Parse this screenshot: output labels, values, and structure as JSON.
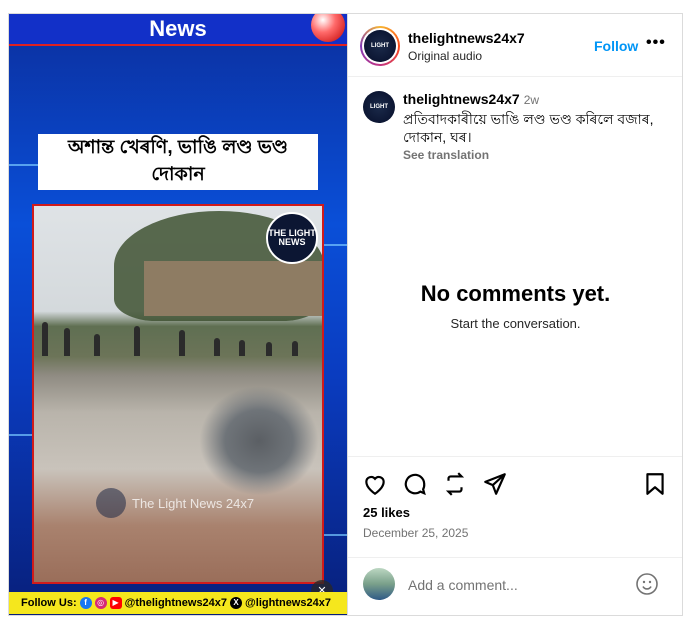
{
  "media": {
    "news_label": "News",
    "headline_line1": "অশান্ত খেৰণি, ভাঙি লণ্ড ভণ্ড",
    "headline_line2": "দোকান",
    "logo_text": "THE LIGHT NEWS",
    "watermark": "The Light News 24x7",
    "follow_bar": {
      "label": "Follow Us:",
      "handle1": "@thelightnews24x7",
      "handle2": "@lightnews24x7"
    }
  },
  "header": {
    "username": "thelightnews24x7",
    "audio": "Original audio",
    "follow_label": "Follow",
    "more_label": "•••"
  },
  "caption": {
    "username": "thelightnews24x7",
    "time": "2w",
    "text": "প্ৰতিবাদকাৰীয়ে ভাঙি লণ্ড ভণ্ড কৰিলে বজাৰ, দোকান, ঘৰ।",
    "see_translation": "See translation"
  },
  "comments": {
    "empty_title": "No comments yet.",
    "empty_subtitle": "Start the conversation."
  },
  "engagement": {
    "likes": "25 likes",
    "date": "December 25, 2025"
  },
  "composer": {
    "placeholder": "Add a comment..."
  },
  "icons": [
    "heart-icon",
    "comment-icon",
    "repost-icon",
    "share-icon",
    "bookmark-icon",
    "emoji-icon",
    "mute-icon"
  ],
  "colors": {
    "accent": "#0095f6",
    "follow_bar": "#f5e71d",
    "frame_red": "#d01b1b"
  }
}
